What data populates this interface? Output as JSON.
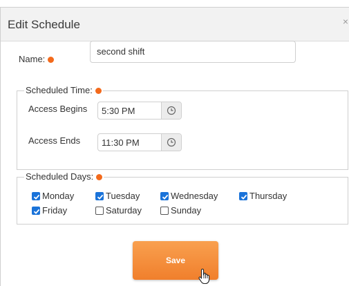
{
  "dialog": {
    "title": "Edit Schedule",
    "close_glyph": "×"
  },
  "name": {
    "label": "Name:",
    "value": "second shift"
  },
  "scheduled_time": {
    "legend": "Scheduled Time:",
    "begins_label": "Access Begins",
    "begins_value": "5:30 PM",
    "ends_label": "Access Ends",
    "ends_value": "11:30 PM"
  },
  "scheduled_days": {
    "legend": "Scheduled Days:",
    "days": [
      {
        "label": "Monday",
        "checked": true
      },
      {
        "label": "Tuesday",
        "checked": true
      },
      {
        "label": "Wednesday",
        "checked": true
      },
      {
        "label": "Thursday",
        "checked": true
      },
      {
        "label": "Friday",
        "checked": true
      },
      {
        "label": "Saturday",
        "checked": false
      },
      {
        "label": "Sunday",
        "checked": false
      }
    ]
  },
  "actions": {
    "save_label": "Save"
  },
  "colors": {
    "required_dot": "#f36a1c",
    "checkbox_checked": "#1a73d9",
    "save_button": "#f07f2c"
  },
  "icons": [
    "close-icon",
    "required-dot",
    "clock-icon",
    "checkmark-icon",
    "hand-cursor-icon"
  ]
}
